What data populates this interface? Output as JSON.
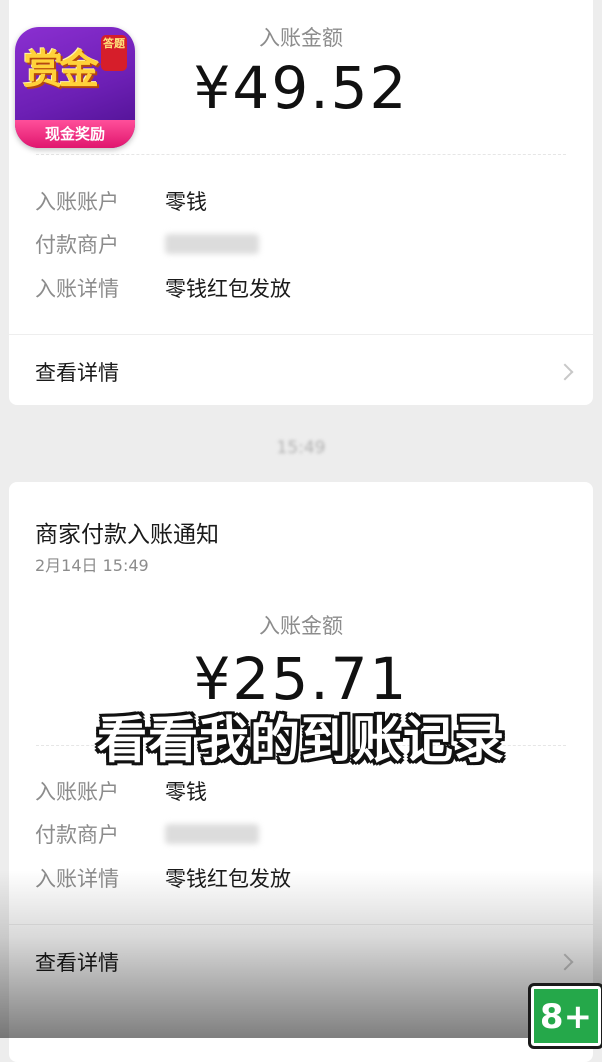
{
  "card1": {
    "amount_label": "入账金额",
    "amount": "¥49.52",
    "rows": [
      {
        "key": "入账账户",
        "value": "零钱"
      },
      {
        "key": "付款商户",
        "value": ""
      },
      {
        "key": "入账详情",
        "value": "零钱红包发放"
      }
    ],
    "detail_link": "查看详情"
  },
  "time_separator": "15:49",
  "card2": {
    "title": "商家付款入账通知",
    "date": "2月14日 15:49",
    "amount_label": "入账金额",
    "amount": "¥25.71",
    "rows": [
      {
        "key": "入账账户",
        "value": "零钱"
      },
      {
        "key": "付款商户",
        "value": ""
      },
      {
        "key": "入账详情",
        "value": "零钱红包发放"
      }
    ],
    "detail_link": "查看详情"
  },
  "app_icon": {
    "main_text": "赏金",
    "seal_text": "答题",
    "banner_text": "现金奖励"
  },
  "caption": "看看我的到账记录",
  "age_badge": "8+",
  "colors": {
    "background": "#ededed",
    "card": "#ffffff",
    "label_gray": "#8c8c8c",
    "badge_green": "#25a84a"
  }
}
